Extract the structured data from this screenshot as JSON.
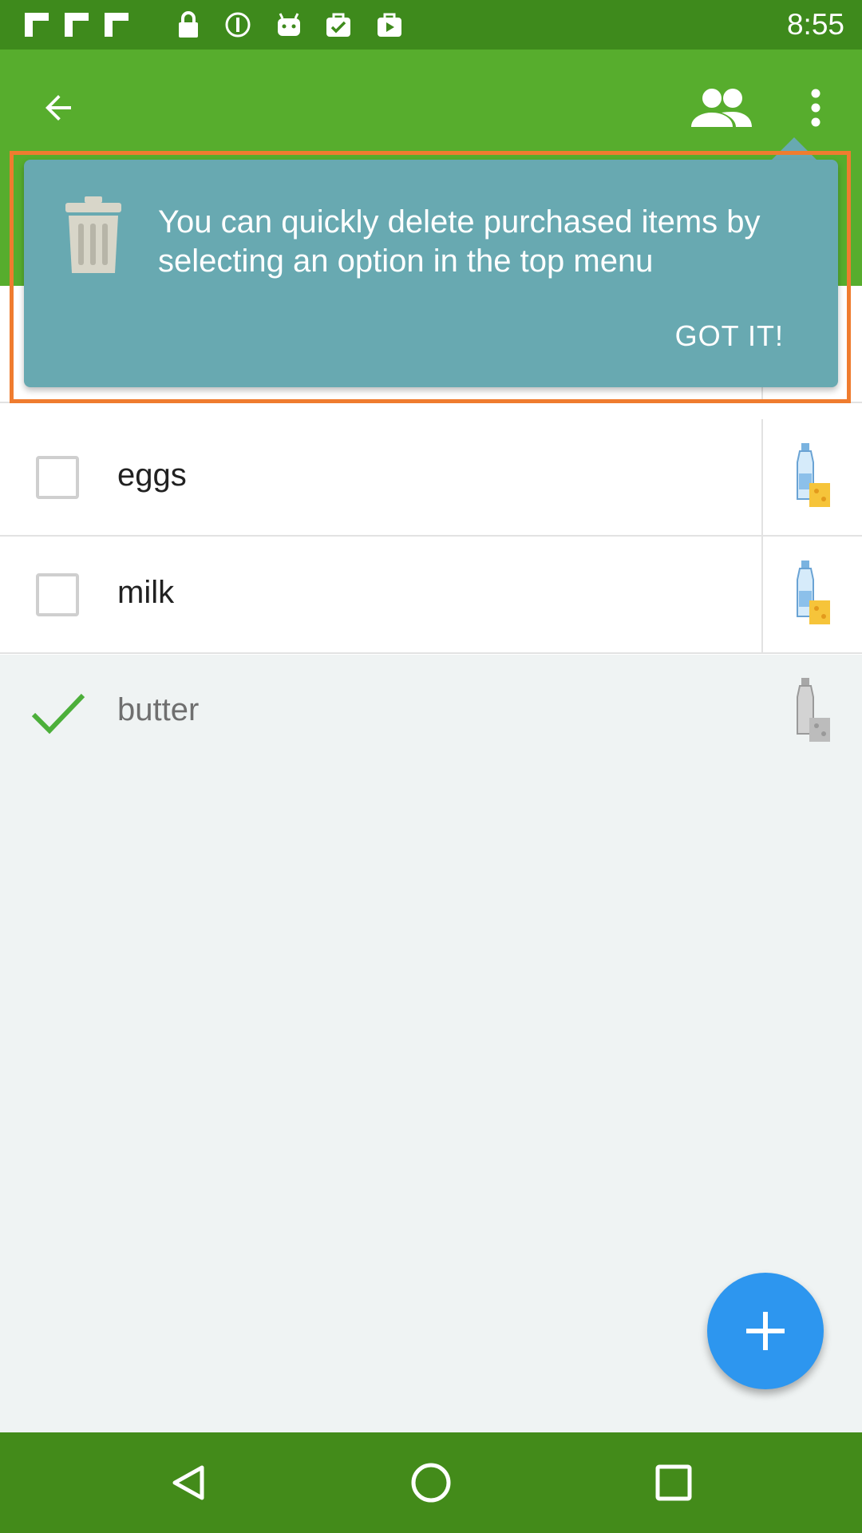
{
  "status_bar": {
    "time": "8:55",
    "icons": [
      "flipboard-icon",
      "flipboard-icon",
      "flipboard-icon",
      "lock-icon",
      "info-icon",
      "android-icon",
      "checklist-bag-icon",
      "play-bag-icon"
    ]
  },
  "app_bar": {
    "back_icon": "arrow-back-icon",
    "share_icon": "people-icon",
    "menu_icon": "more-vert-icon"
  },
  "tooltip": {
    "icon": "trash-icon",
    "message": "You can quickly delete purchased items by selecting an option in the top menu",
    "action_label": "GOT IT!"
  },
  "list": {
    "items": [
      {
        "label": "eggs",
        "checked": false,
        "category_icon": "dairy-icon"
      },
      {
        "label": "milk",
        "checked": false,
        "category_icon": "dairy-icon"
      },
      {
        "label": "butter",
        "checked": true,
        "category_icon": "dairy-icon"
      }
    ]
  },
  "fab": {
    "icon": "plus-icon"
  },
  "nav_bar": {
    "icons": [
      "back-triangle-icon",
      "home-circle-icon",
      "recents-square-icon"
    ]
  },
  "colors": {
    "status_bar": "#3e8a1c",
    "app_bar": "#57ad2d",
    "tooltip": "#68a9b1",
    "highlight": "#ef7c2f",
    "fab": "#2d96ef",
    "check": "#4caf3a",
    "nav_bar": "#438b1a"
  }
}
